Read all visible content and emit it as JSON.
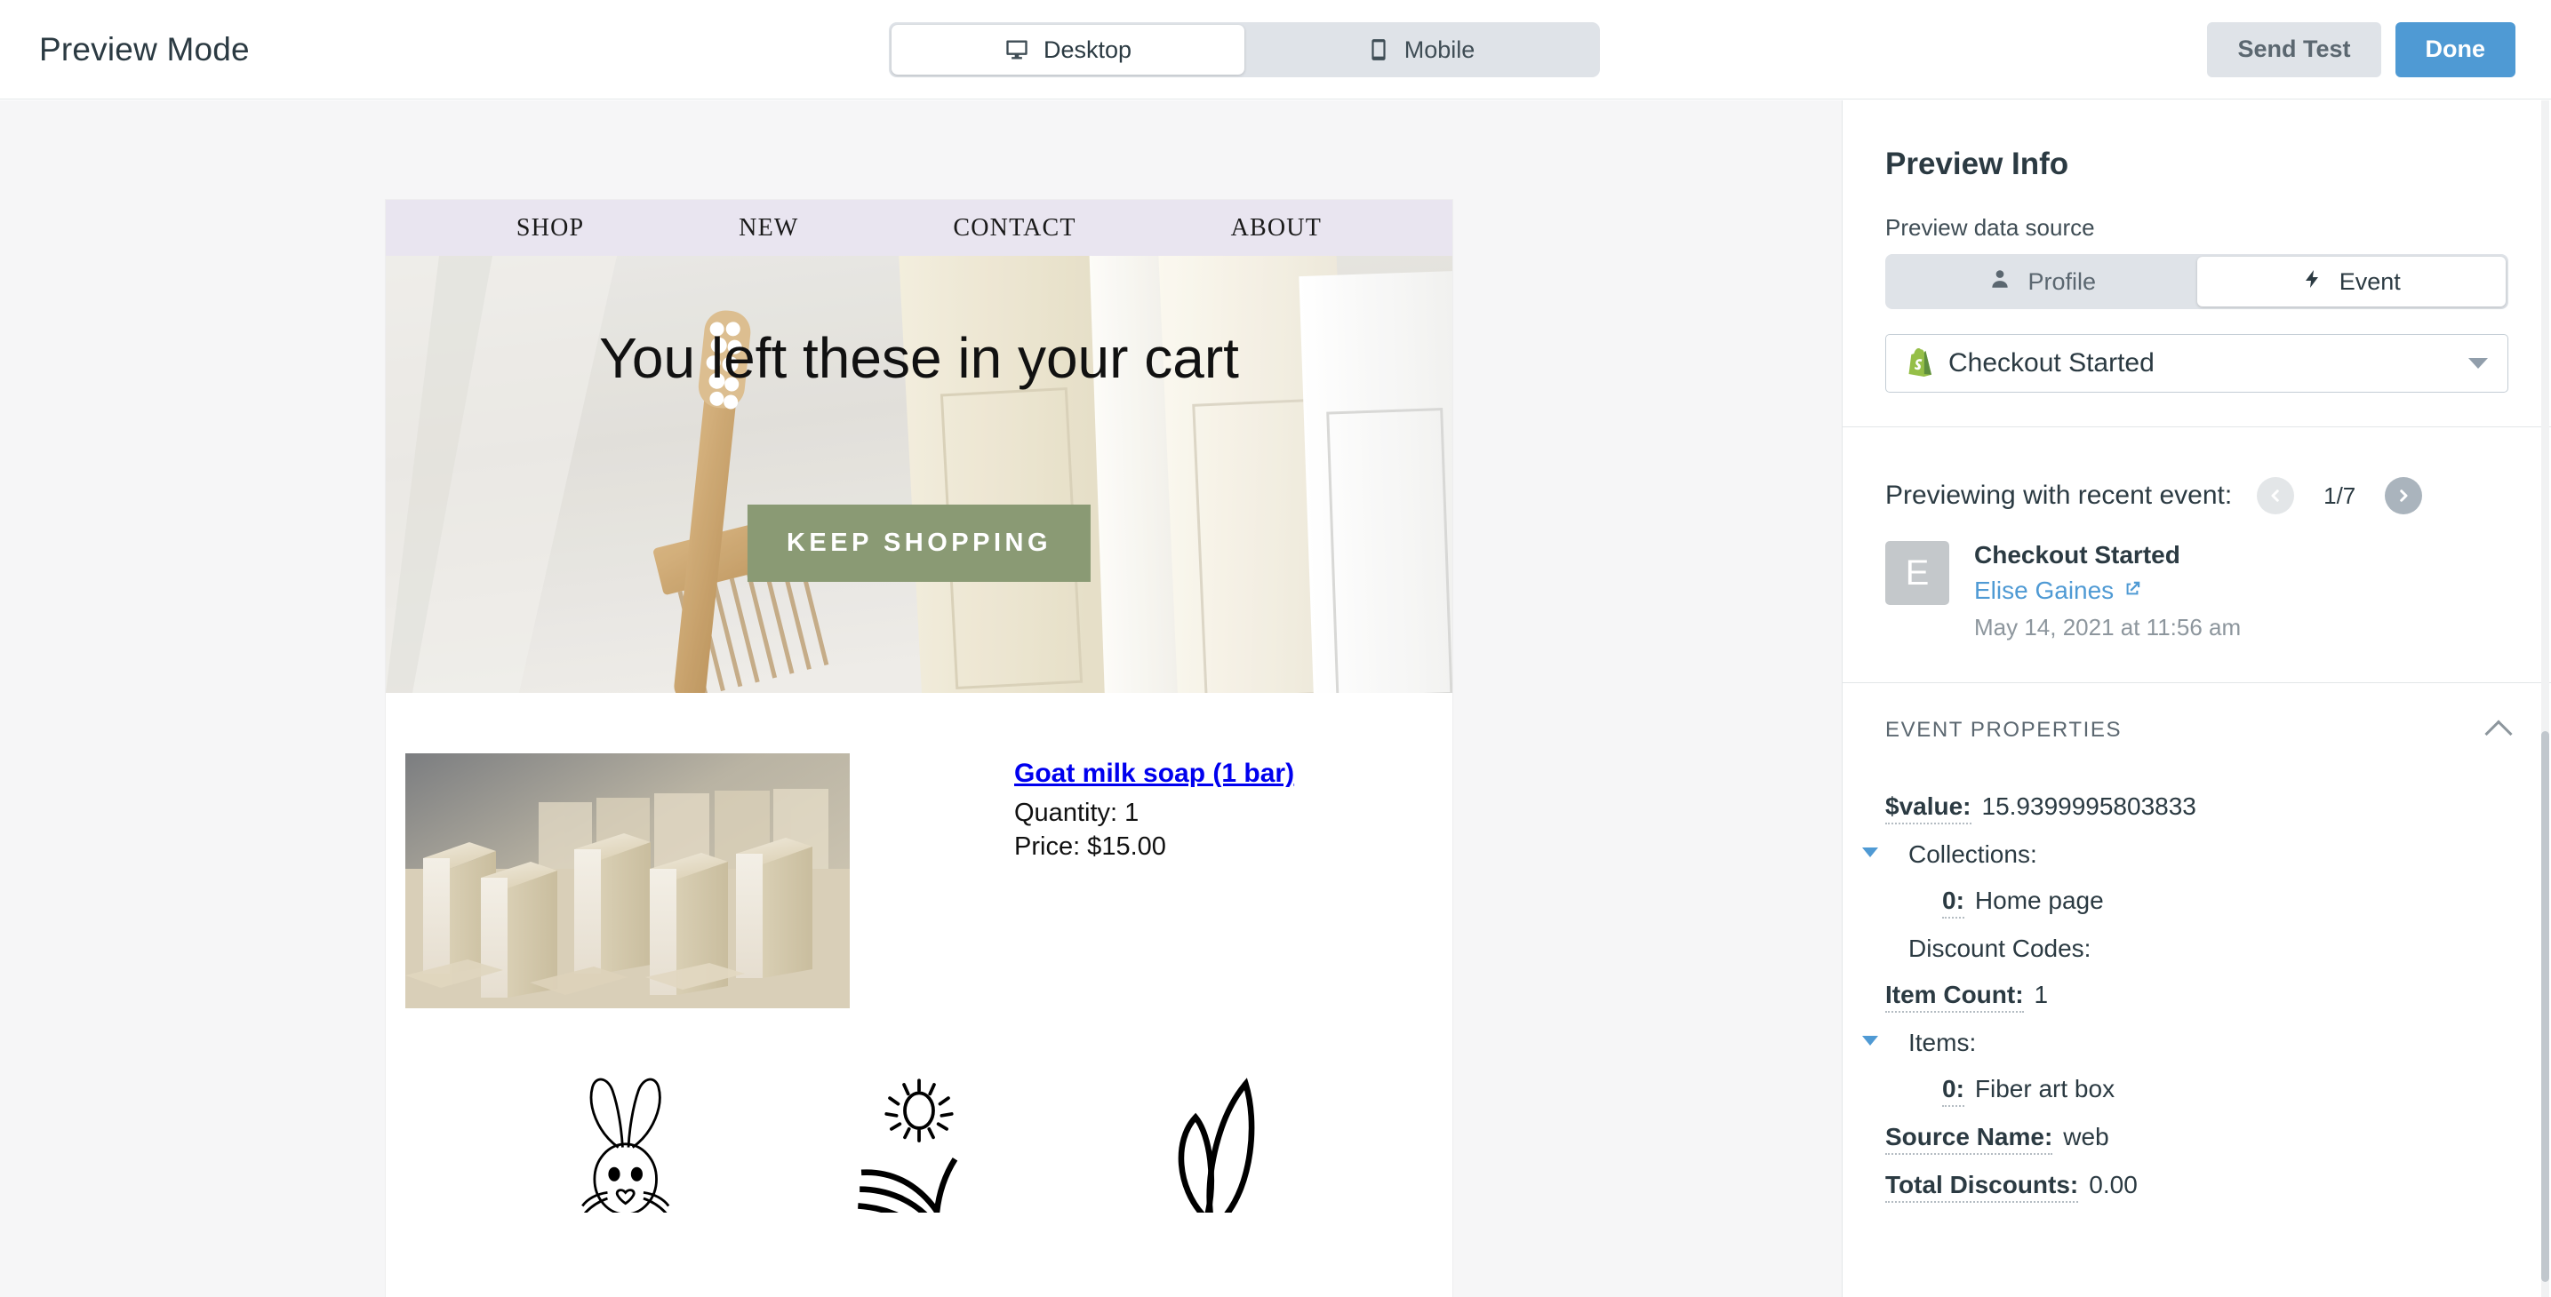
{
  "header": {
    "title": "Preview Mode",
    "device_tabs": [
      {
        "label": "Desktop",
        "icon": "desktop-icon",
        "active": true
      },
      {
        "label": "Mobile",
        "icon": "mobile-icon",
        "active": false
      }
    ],
    "send_test_label": "Send Test",
    "done_label": "Done"
  },
  "email": {
    "nav": [
      "SHOP",
      "NEW",
      "CONTACT",
      "ABOUT"
    ],
    "hero": {
      "headline": "You left these in your cart",
      "cta_label": "KEEP SHOPPING",
      "cta_color": "#8a9a74"
    },
    "product": {
      "title": "Goat milk soap (1 bar)",
      "quantity_line": "Quantity: 1",
      "price_line": "Price: $15.00",
      "link_color": "#0000ee"
    },
    "feature_icons": [
      "bunny-icon",
      "sun-over-field-icon",
      "leaf-plant-icon"
    ]
  },
  "sidebar": {
    "title": "Preview Info",
    "data_source_label": "Preview data source",
    "source_tabs": [
      {
        "label": "Profile",
        "icon": "person-icon",
        "active": false
      },
      {
        "label": "Event",
        "icon": "lightning-bolt-icon",
        "active": true
      }
    ],
    "event_select": {
      "value": "Checkout Started",
      "icon": "shopify-icon",
      "icon_color": "#95bf47"
    },
    "recent": {
      "label": "Previewing with recent event:",
      "count": "1/7",
      "prev_enabled": false,
      "next_enabled": true,
      "avatar_initial": "E",
      "event_name": "Checkout Started",
      "person": "Elise Gaines",
      "person_link_color": "#4f9ad4",
      "timestamp": "May 14, 2021 at 11:56 am"
    },
    "properties": {
      "header": "EVENT PROPERTIES",
      "collapsed": false,
      "rows": [
        {
          "key": "$value:",
          "value": "15.9399995803833",
          "indent": 0,
          "dotted": true,
          "disclosure": false
        },
        {
          "key": "Collections:",
          "value": "",
          "indent": 0,
          "dotted": false,
          "disclosure": true
        },
        {
          "key": "0:",
          "value": "Home page",
          "indent": 1,
          "dotted": true,
          "disclosure": false
        },
        {
          "key": "Discount Codes:",
          "value": "",
          "indent": 0,
          "dotted": false,
          "disclosure": false
        },
        {
          "key": "Item Count:",
          "value": "1",
          "indent": 0,
          "dotted": true,
          "disclosure": false
        },
        {
          "key": "Items:",
          "value": "",
          "indent": 0,
          "dotted": false,
          "disclosure": true
        },
        {
          "key": "0:",
          "value": "Fiber art box",
          "indent": 1,
          "dotted": true,
          "disclosure": false
        },
        {
          "key": "Source Name:",
          "value": "web",
          "indent": 0,
          "dotted": true,
          "disclosure": false
        },
        {
          "key": "Total Discounts:",
          "value": "0.00",
          "indent": 0,
          "dotted": true,
          "disclosure": false
        }
      ]
    }
  }
}
